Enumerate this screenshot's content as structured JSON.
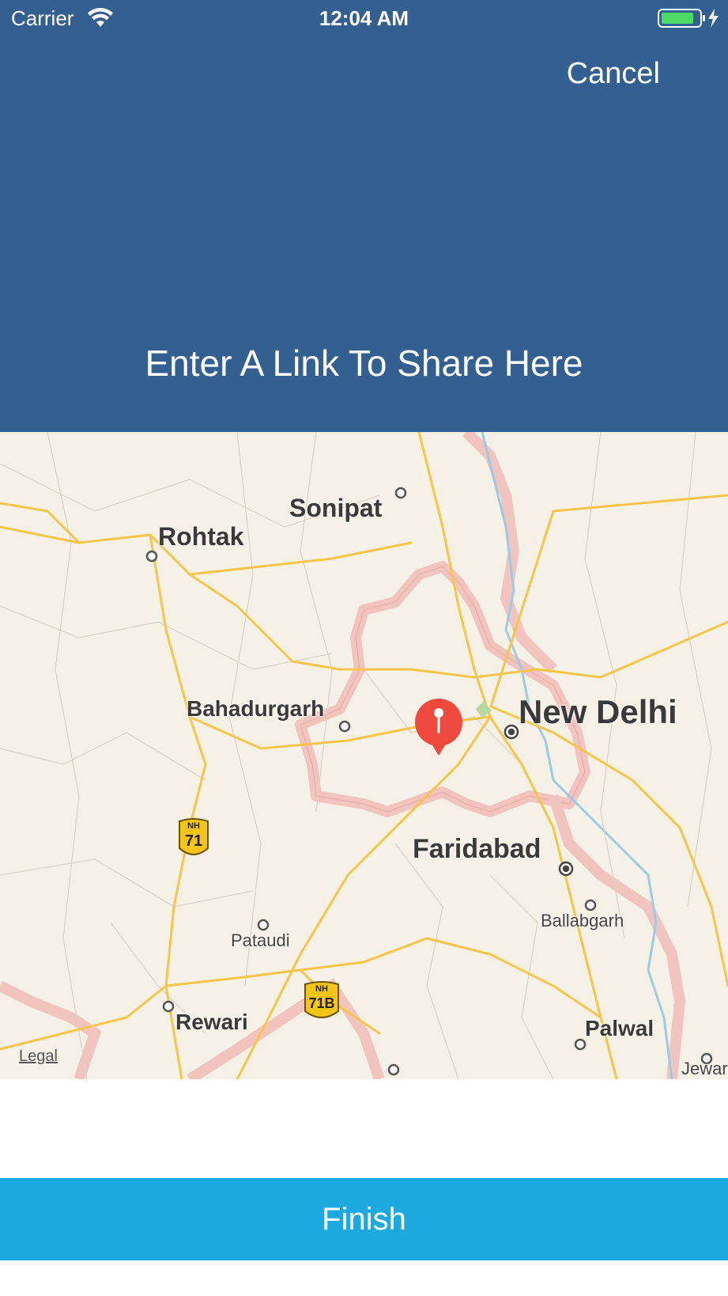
{
  "status_bar": {
    "carrier": "Carrier",
    "time": "12:04 AM",
    "wifi_icon": "wifi-icon",
    "battery_icon": "battery-charging-icon"
  },
  "header": {
    "cancel_label": "Cancel",
    "link_prompt": "Enter A Link To Share Here",
    "background_color": "#335F91"
  },
  "map": {
    "labels": {
      "sonipat": "Sonipat",
      "rohtak": "Rohtak",
      "bahadurgarh": "Bahadurgarh",
      "new_delhi": "New Delhi",
      "faridabad": "Faridabad",
      "ballabgarh": "Ballabgarh",
      "pataudi": "Pataudi",
      "rewari": "Rewari",
      "palwal": "Palwal",
      "jewar": "Jewar"
    },
    "highways": [
      {
        "prefix": "NH",
        "number": "71"
      },
      {
        "prefix": "NH",
        "number": "71B"
      }
    ],
    "legal_label": "Legal",
    "pin_icon": "map-pin-icon",
    "pin_color": "#F04A3E"
  },
  "footer": {
    "finish_label": "Finish",
    "button_color": "#1CA9E0"
  }
}
